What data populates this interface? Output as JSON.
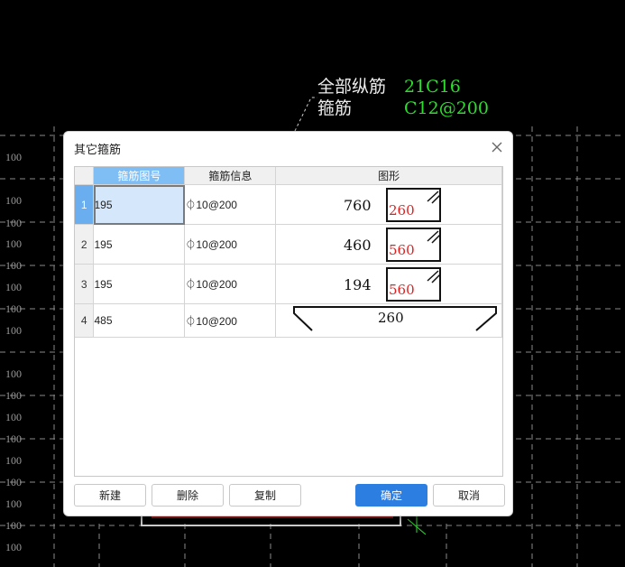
{
  "cad": {
    "row_labels": [
      "100",
      "100",
      "100",
      "100",
      "100",
      "100",
      "100",
      "100",
      "100",
      "100",
      "100",
      "100",
      "100",
      "100",
      "100",
      "100",
      "100",
      "100"
    ],
    "annotation": {
      "all_long_rebar_label": "全部纵筋",
      "all_long_rebar_value": "21C16",
      "stirrup_label": "箍筋",
      "stirrup_value": "C12@200"
    }
  },
  "dialog": {
    "title": "其它箍筋",
    "columns": [
      "箍筋图号",
      "箍筋信息",
      "图形"
    ],
    "rows": [
      {
        "num": "1",
        "code": "195",
        "info": "⏀10@200",
        "shape_left": "760",
        "shape_inner": "260"
      },
      {
        "num": "2",
        "code": "195",
        "info": "⏀10@200",
        "shape_left": "460",
        "shape_inner": "560"
      },
      {
        "num": "3",
        "code": "195",
        "info": "⏀10@200",
        "shape_left": "194",
        "shape_inner": "560"
      },
      {
        "num": "4",
        "code": "485",
        "info": "⏀10@200",
        "shape_center": "260"
      }
    ],
    "buttons": {
      "new": "新建",
      "delete": "删除",
      "copy": "复制",
      "ok": "确定",
      "cancel": "取消"
    }
  },
  "colors": {
    "accent": "#2d7ee1",
    "cad_green": "#2ddf2d",
    "shape_red": "#e02020"
  }
}
